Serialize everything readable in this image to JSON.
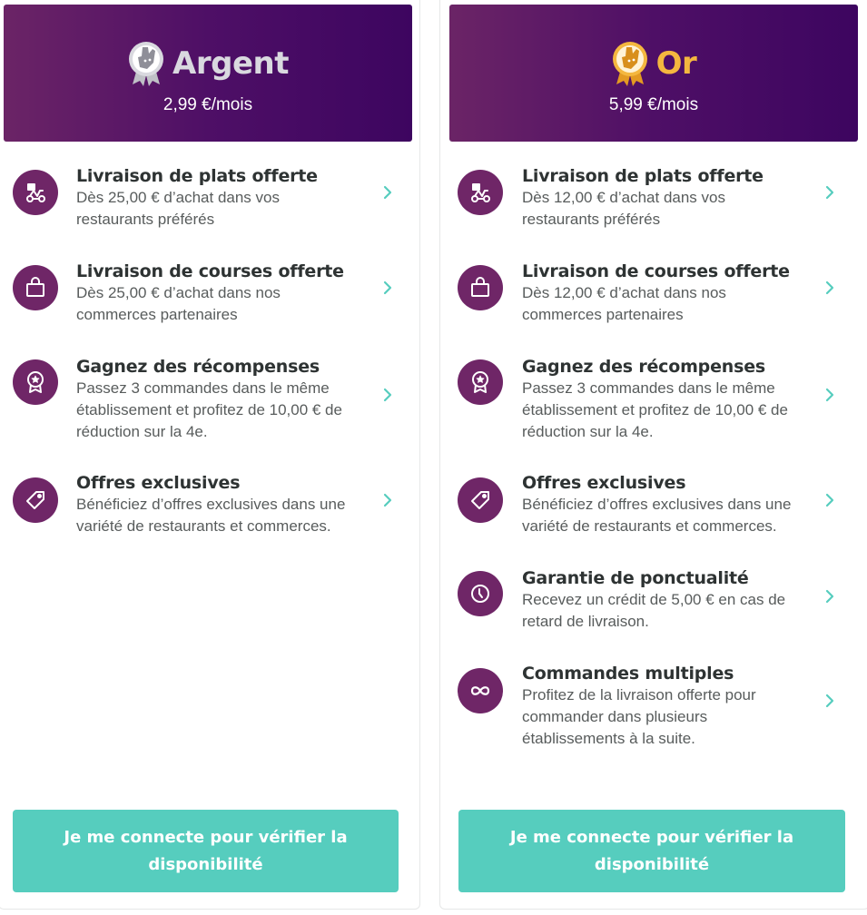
{
  "colors": {
    "header_gradient": [
      "#6b2466",
      "#3d0560"
    ],
    "icon_circle": "#6f2667",
    "accent_teal": "#56cdbe",
    "silver": "#d9d9df",
    "gold": "#f4b73f"
  },
  "plans": [
    {
      "name": "Argent",
      "price": "2,99 €/mois",
      "badge_icon": "deliveroo-silver-badge-icon",
      "features": [
        {
          "icon": "scooter-icon",
          "title": "Livraison de plats offerte",
          "desc_lines": [
            "Dès 25,00 € d’achat dans vos",
            "restaurants préférés"
          ]
        },
        {
          "icon": "shopping-bag-icon",
          "title": "Livraison de courses offerte",
          "desc_lines": [
            "Dès 25,00 € d’achat dans nos",
            "commerces partenaires"
          ]
        },
        {
          "icon": "reward-badge-icon",
          "title": "Gagnez des récompenses",
          "desc_lines": [
            "Passez 3 commandes dans le même",
            "établissement et profitez de 10,00 € de",
            "réduction sur la 4e."
          ]
        },
        {
          "icon": "tag-icon",
          "title": "Offres exclusives",
          "desc_lines": [
            "Bénéficiez d’offres exclusives dans une",
            "variété de restaurants et commerces."
          ]
        }
      ],
      "cta": "Je me connecte pour vérifier la disponibilité"
    },
    {
      "name": "Or",
      "price": "5,99 €/mois",
      "badge_icon": "deliveroo-gold-badge-icon",
      "features": [
        {
          "icon": "scooter-icon",
          "title": "Livraison de plats offerte",
          "desc_lines": [
            "Dès 12,00 € d’achat dans vos",
            "restaurants préférés"
          ]
        },
        {
          "icon": "shopping-bag-icon",
          "title": "Livraison de courses offerte",
          "desc_lines": [
            "Dès 12,00 € d’achat dans nos",
            "commerces partenaires"
          ]
        },
        {
          "icon": "reward-badge-icon",
          "title": "Gagnez des récompenses",
          "desc_lines": [
            "Passez 3 commandes dans le même",
            "établissement et profitez de 10,00 € de",
            "réduction sur la 4e."
          ]
        },
        {
          "icon": "tag-icon",
          "title": "Offres exclusives",
          "desc_lines": [
            "Bénéficiez d’offres exclusives dans une",
            "variété de restaurants et commerces."
          ]
        },
        {
          "icon": "clock-icon",
          "title": "Garantie de ponctualité",
          "desc_lines": [
            "Recevez un crédit de 5,00 € en cas de",
            "retard de livraison."
          ]
        },
        {
          "icon": "infinity-icon",
          "title": "Commandes multiples",
          "desc_lines": [
            "Profitez de la livraison offerte pour",
            "commander dans plusieurs",
            "établissements à la suite."
          ]
        }
      ],
      "cta": "Je me connecte pour vérifier la disponibilité"
    }
  ]
}
